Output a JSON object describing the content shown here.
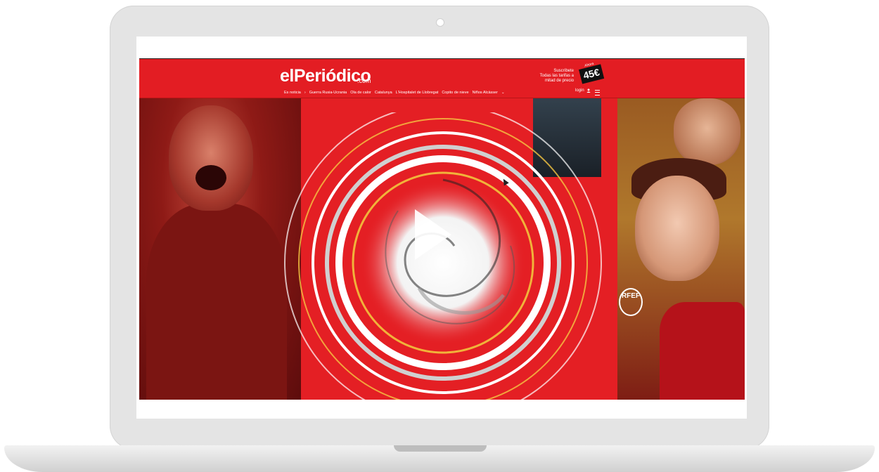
{
  "header": {
    "logo": "elPeriódico",
    "logo_suffix": ".com",
    "promo": {
      "line1": "Suscríbete",
      "line2": "Todas las tarifas a",
      "line3": "mitad de precio",
      "badge_small": "Ahora",
      "badge_big": "45€"
    },
    "login_label": "login"
  },
  "nav": {
    "lead": "Es noticia",
    "items": [
      "Guerra Rusia-Ucrania",
      "Ola de calor",
      "Catalunya",
      "L'Hospitalet de Llobregat",
      "Copito de nieve",
      "Niños Alcàsser"
    ]
  },
  "video": {
    "sponsor_logo": "RFEF"
  },
  "colors": {
    "brand_red": "#e31d23",
    "white": "#ffffff"
  },
  "icons": [
    "user-icon",
    "menu-icon",
    "play-icon",
    "cursor-icon",
    "camera-icon"
  ]
}
